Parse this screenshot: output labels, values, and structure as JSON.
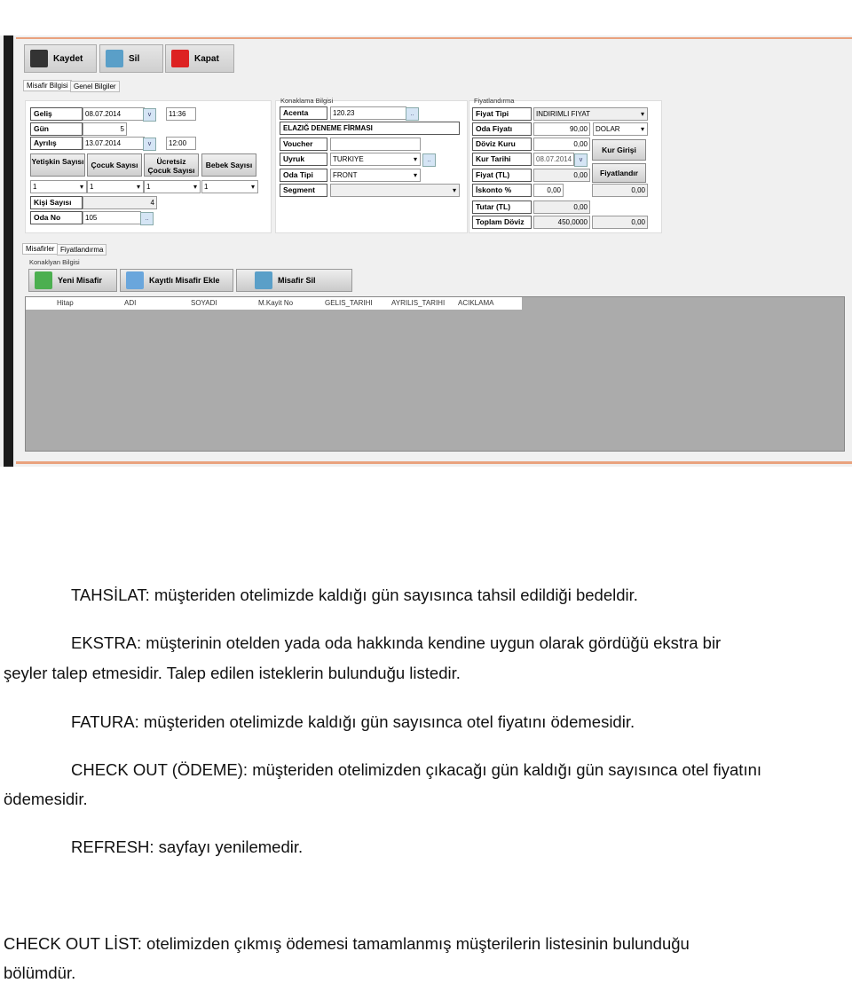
{
  "toolbar": {
    "save": "Kaydet",
    "delete": "Sil",
    "close": "Kapat"
  },
  "tabs_top": [
    "Misafir Bilgisi",
    "Genel Bilgiler"
  ],
  "guest": {
    "gelis_label": "Geliş",
    "gelis_date": "08.07.2014",
    "gelis_time": "11:36",
    "gun_label": "Gün",
    "gun": "5",
    "ayrilis_label": "Ayrılış",
    "ayrilis_date": "13.07.2014",
    "ayrilis_time": "12:00",
    "counts": [
      {
        "label": "Yetişkin Sayısı",
        "value": "1"
      },
      {
        "label": "Çocuk Sayısı",
        "value": "1"
      },
      {
        "label": "Ücretsiz Çocuk Sayısı",
        "value": "1"
      },
      {
        "label": "Bebek Sayısı",
        "value": "1"
      }
    ],
    "kisi_label": "Kişi Sayısı",
    "kisi": "4",
    "oda_label": "Oda No",
    "oda": "105"
  },
  "konaklama": {
    "title": "Konaklama Bilgisi",
    "acenta_label": "Acenta",
    "acenta": "120.23",
    "firma": "ELAZIĞ DENEME FİRMASI",
    "voucher_label": "Voucher",
    "voucher": "",
    "uyruk_label": "Uyruk",
    "uyruk": "TURKIYE",
    "odatipi_label": "Oda Tipi",
    "odatipi": "FRONT",
    "segment_label": "Segment",
    "segment": ""
  },
  "fiyat": {
    "title": "Fiyatlandırma",
    "tip_label": "Fiyat Tipi",
    "tip": "INDIRIMLI FIYAT",
    "oda_label": "Oda Fiyatı",
    "oda": "90,00",
    "currency": "DOLAR",
    "doviz_label": "Döviz Kuru",
    "doviz": "0,00",
    "kurgiris": "Kur Girişi",
    "kurtarih_label": "Kur Tarihi",
    "kurtarih": "08.07.2014",
    "fiyattl_label": "Fiyat (TL)",
    "fiyattl": "0,00",
    "fiyatlandir": "Fiyatlandır",
    "iskonto_label": "İskonto %",
    "iskonto": "0,00",
    "iskonto2": "0,00",
    "tutar_label": "Tutar (TL)",
    "tutar": "0,00",
    "toplam_label": "Toplam Döviz",
    "toplam": "450,0000",
    "toplam2": "0,00"
  },
  "tabs_bottom": [
    "Misafirler",
    "Fiyatlandırma"
  ],
  "konaklayan": {
    "title": "Konaklyan Bilgisi",
    "new": "Yeni Misafir",
    "add": "Kayıtlı Misafir Ekle",
    "del": "Misafir Sil"
  },
  "grid_headers": [
    "Hitap",
    "ADI",
    "SOYADI",
    "M.Kayit No",
    "GELIS_TARIHI",
    "AYRILIS_TARIHI",
    "ACIKLAMA"
  ],
  "text": {
    "p1": "TAHSİLAT: müşteriden otelimizde kaldığı gün sayısınca tahsil edildiği bedeldir.",
    "p2a": "EKSTRA: müşterinin otelden yada oda hakkında kendine uygun olarak gördüğü ekstra bir",
    "p2b": "şeyler talep etmesidir. Talep edilen isteklerin bulunduğu listedir.",
    "p3": "FATURA: müşteriden otelimizde kaldığı gün sayısınca otel fiyatını ödemesidir.",
    "p4a": "CHECK OUT (ÖDEME): müşteriden otelimizden çıkacağı gün kaldığı gün sayısınca otel fiyatını",
    "p4b": "ödemesidir.",
    "p5": "REFRESH: sayfayı yenilemedir.",
    "p6a": "CHECK OUT LİST: otelimizden çıkmış ödemesi tamamlanmış müşterilerin listesinin bulunduğu",
    "p6b": "bölümdür."
  }
}
